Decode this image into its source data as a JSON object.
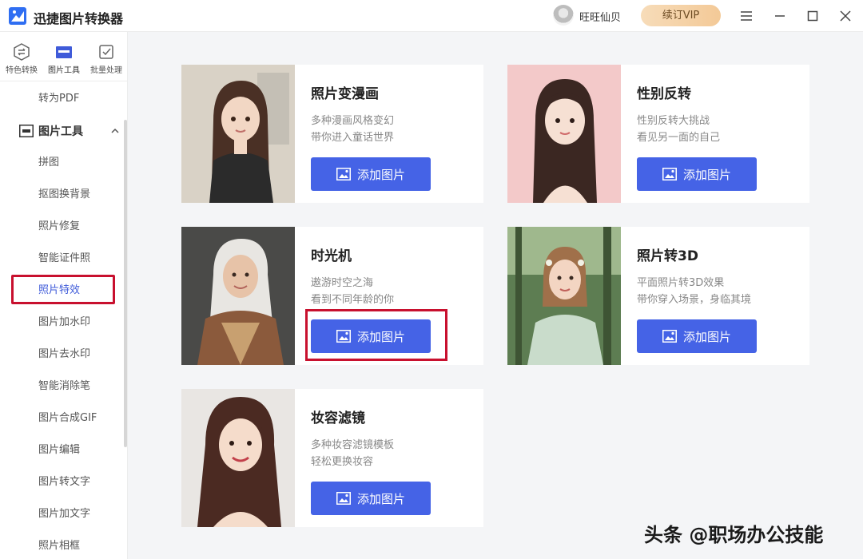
{
  "app": {
    "title": "迅捷图片转换器",
    "username": "旺旺仙贝",
    "vip_label": "续订VIP"
  },
  "window_controls": [
    "menu-icon",
    "minimize-icon",
    "maximize-icon",
    "close-icon"
  ],
  "sidebar": {
    "top_tabs": [
      {
        "label": "特色转换",
        "icon": "convert-icon"
      },
      {
        "label": "图片工具",
        "icon": "image-tools-icon",
        "active": true
      },
      {
        "label": "批量处理",
        "icon": "batch-icon"
      }
    ],
    "items_before_group": [
      {
        "label": "转为PDF"
      }
    ],
    "group": {
      "label": "图片工具",
      "icon": "image-tools-icon",
      "expanded": true
    },
    "items": [
      {
        "label": "拼图"
      },
      {
        "label": "抠图换背景"
      },
      {
        "label": "照片修复"
      },
      {
        "label": "智能证件照"
      },
      {
        "label": "照片特效",
        "selected": true
      },
      {
        "label": "图片加水印"
      },
      {
        "label": "图片去水印"
      },
      {
        "label": "智能消除笔"
      },
      {
        "label": "图片合成GIF"
      },
      {
        "label": "图片编辑"
      },
      {
        "label": "图片转文字"
      },
      {
        "label": "图片加文字"
      },
      {
        "label": "照片相框"
      }
    ]
  },
  "cards": [
    {
      "title": "照片变漫画",
      "desc1": "多种漫画风格变幻",
      "desc2": "带你进入童话世界",
      "button": "添加图片"
    },
    {
      "title": "性别反转",
      "desc1": "性别反转大挑战",
      "desc2": "看见另一面的自己",
      "button": "添加图片"
    },
    {
      "title": "时光机",
      "desc1": "遨游时空之海",
      "desc2": "看到不同年龄的你",
      "button": "添加图片",
      "highlighted": true
    },
    {
      "title": "照片转3D",
      "desc1": "平面照片转3D效果",
      "desc2": "带你穿入场景，身临其境",
      "button": "添加图片"
    },
    {
      "title": "妆容滤镜",
      "desc1": "多种妆容滤镜模板",
      "desc2": "轻松更换妆容",
      "button": "添加图片"
    }
  ],
  "watermark": "头条 @职场办公技能",
  "colors": {
    "accent": "#4563e6",
    "highlight": "#c8102e",
    "vip_gold": "#f3c997"
  }
}
